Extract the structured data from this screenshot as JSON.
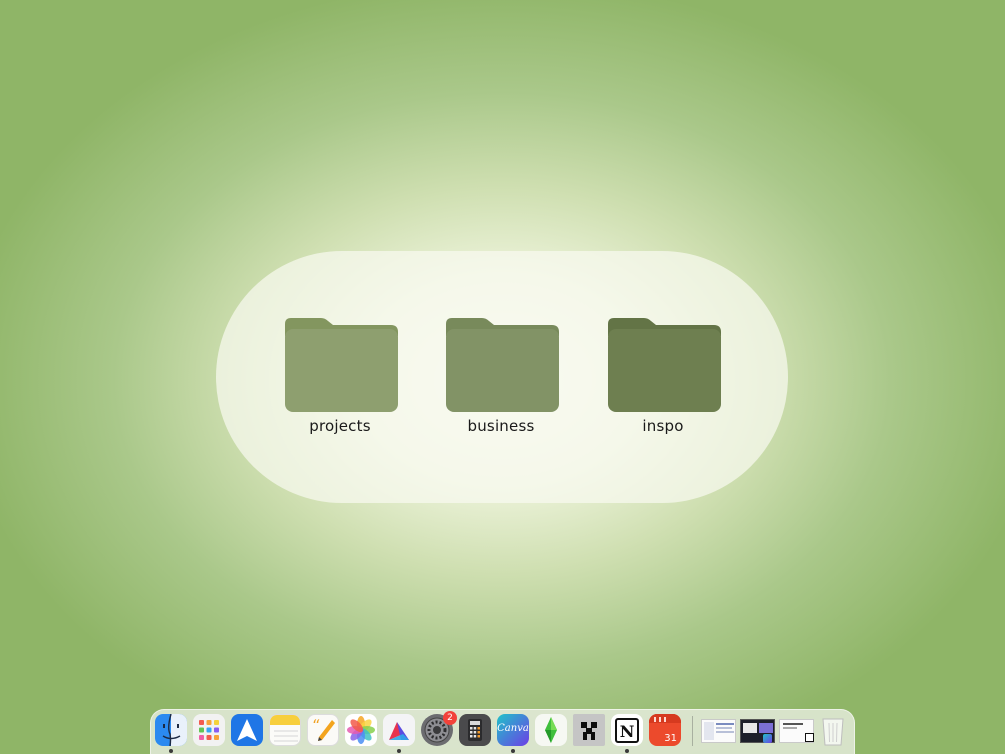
{
  "desktop": {
    "folders": [
      {
        "label": "projects",
        "color": "#8e9f6f",
        "tab_color": "#83965f"
      },
      {
        "label": "business",
        "color": "#829366",
        "tab_color": "#788a5b"
      },
      {
        "label": "inspo",
        "color": "#6e7f50",
        "tab_color": "#637446"
      }
    ]
  },
  "dock": {
    "apps": [
      {
        "name": "Finder",
        "icon": "finder-icon",
        "running": true
      },
      {
        "name": "Launchpad",
        "icon": "launchpad-icon",
        "running": false
      },
      {
        "name": "Spark",
        "icon": "spark-icon",
        "running": false
      },
      {
        "name": "Notes",
        "icon": "notes-icon",
        "running": false
      },
      {
        "name": "Pages",
        "icon": "pages-icon",
        "running": false
      },
      {
        "name": "Photos",
        "icon": "photos-icon",
        "running": false
      },
      {
        "name": "Affinity",
        "icon": "affinity-icon",
        "running": true
      },
      {
        "name": "System Settings",
        "icon": "gear-icon",
        "running": false,
        "badge": "2"
      },
      {
        "name": "Calculator",
        "icon": "calculator-icon",
        "running": false
      },
      {
        "name": "Canva",
        "icon": "canva-icon",
        "running": true,
        "label": "Canva"
      },
      {
        "name": "The Sims",
        "icon": "plumbob-icon",
        "running": false
      },
      {
        "name": "Minecraft",
        "icon": "creeper-icon",
        "running": false
      },
      {
        "name": "Notion",
        "icon": "notion-icon",
        "running": true
      },
      {
        "name": "Fantastical",
        "icon": "calendar-icon",
        "running": false,
        "label": "31"
      }
    ],
    "minimized_windows": [
      {
        "name": "window-thumbnail-1",
        "icon": "window-thumbnail-icon"
      },
      {
        "name": "window-thumbnail-2",
        "icon": "window-thumbnail-icon"
      },
      {
        "name": "window-thumbnail-3",
        "icon": "window-thumbnail-icon"
      }
    ],
    "trash": {
      "name": "Trash",
      "icon": "trash-icon"
    }
  },
  "colors": {
    "wallpaper_center": "#fafcf3",
    "wallpaper_edge": "#8fb567"
  }
}
